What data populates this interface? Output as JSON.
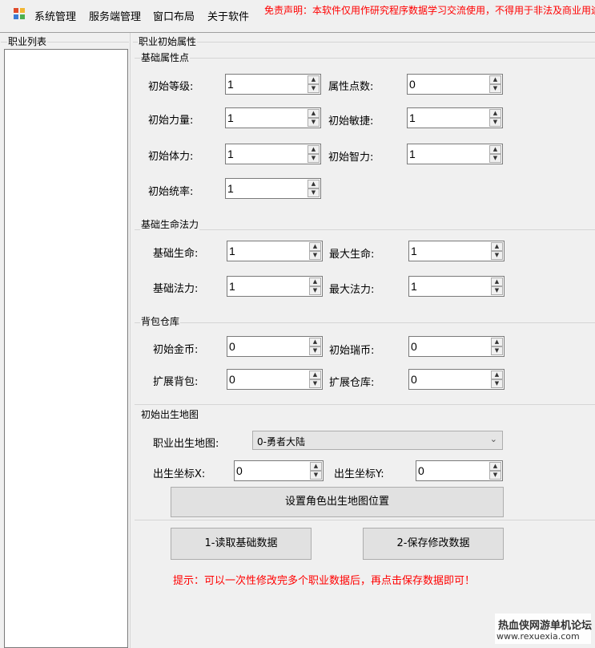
{
  "menu": {
    "items": [
      "系统管理",
      "服务端管理",
      "窗口布局",
      "关于软件"
    ],
    "disclaimer": "免责声明：本软件仅用作研究程序数据学习交流使用，不得用于非法及商业用途"
  },
  "left_panel": {
    "title": "职业列表"
  },
  "main": {
    "title": "职业初始属性",
    "base_attrs": {
      "title": "基础属性点",
      "fields": [
        {
          "label": "初始等级:",
          "value": "1"
        },
        {
          "label": "属性点数:",
          "value": "0"
        },
        {
          "label": "初始力量:",
          "value": "1"
        },
        {
          "label": "初始敏捷:",
          "value": "1"
        },
        {
          "label": "初始体力:",
          "value": "1"
        },
        {
          "label": "初始智力:",
          "value": "1"
        },
        {
          "label": "初始统率:",
          "value": "1"
        }
      ]
    },
    "hp_mp": {
      "title": "基础生命法力",
      "fields": [
        {
          "label": "基础生命:",
          "value": "1"
        },
        {
          "label": "最大生命:",
          "value": "1"
        },
        {
          "label": "基础法力:",
          "value": "1"
        },
        {
          "label": "最大法力:",
          "value": "1"
        }
      ]
    },
    "inventory": {
      "title": "背包仓库",
      "fields": [
        {
          "label": "初始金币:",
          "value": "0"
        },
        {
          "label": "初始瑞币:",
          "value": "0"
        },
        {
          "label": "扩展背包:",
          "value": "0"
        },
        {
          "label": "扩展仓库:",
          "value": "0"
        }
      ]
    },
    "spawn": {
      "title": "初始出生地图",
      "map_label": "职业出生地图:",
      "map_value": "0-勇者大陆",
      "x_label": "出生坐标X:",
      "x_value": "0",
      "y_label": "出生坐标Y:",
      "y_value": "0",
      "set_button": "设置角色出生地图位置"
    },
    "read_button": "1-读取基础数据",
    "save_button": "2-保存修改数据",
    "tip": "提示：可以一次性修改完多个职业数据后，再点击保存数据即可！"
  },
  "watermark": {
    "line1": "热血侠网游单机论坛",
    "line2": "www.rexuexia.com"
  }
}
